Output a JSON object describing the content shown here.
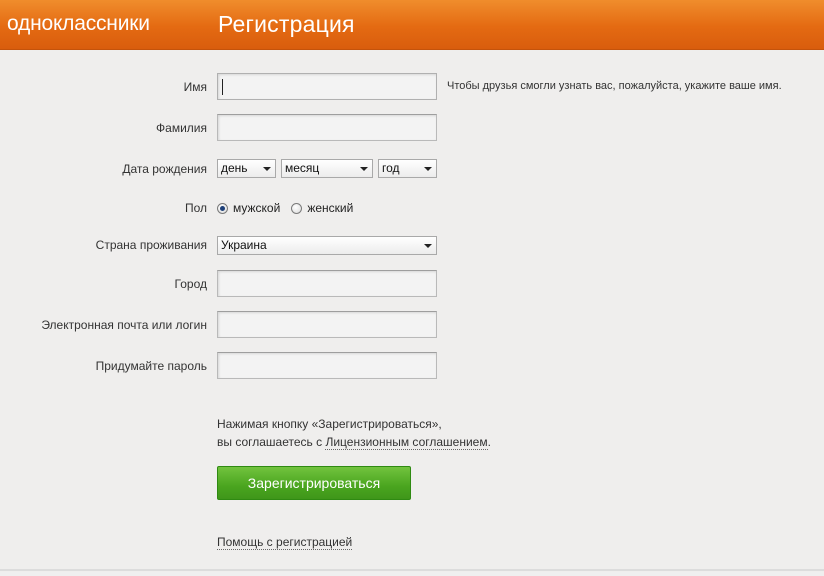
{
  "header": {
    "brand": "одноклассники",
    "title": "Регистрация"
  },
  "form": {
    "first_name": {
      "label": "Имя",
      "value": "",
      "hint": "Чтобы друзья смогли узнать вас, пожалуйста, укажите ваше имя."
    },
    "last_name": {
      "label": "Фамилия",
      "value": ""
    },
    "birth_date": {
      "label": "Дата рождения",
      "day": "день",
      "month": "месяц",
      "year": "год"
    },
    "gender": {
      "label": "Пол",
      "options": [
        "мужской",
        "женский"
      ],
      "selected": "мужской"
    },
    "country": {
      "label": "Страна проживания",
      "value": "Украина"
    },
    "city": {
      "label": "Город",
      "value": ""
    },
    "email": {
      "label": "Электронная почта или логин",
      "value": ""
    },
    "password": {
      "label": "Придумайте пароль",
      "value": ""
    }
  },
  "agreement": {
    "line1": "Нажимая кнопку «Зарегистрироваться»,",
    "line2_prefix": "вы соглашаетесь с ",
    "link_text": "Лицензионным соглашением",
    "line2_suffix": "."
  },
  "submit_label": "Зарегистрироваться",
  "help_link": "Помощь с регистрацией",
  "colors": {
    "header_orange": "#e46a12",
    "button_green": "#4aa51f",
    "background": "#efeeed"
  }
}
